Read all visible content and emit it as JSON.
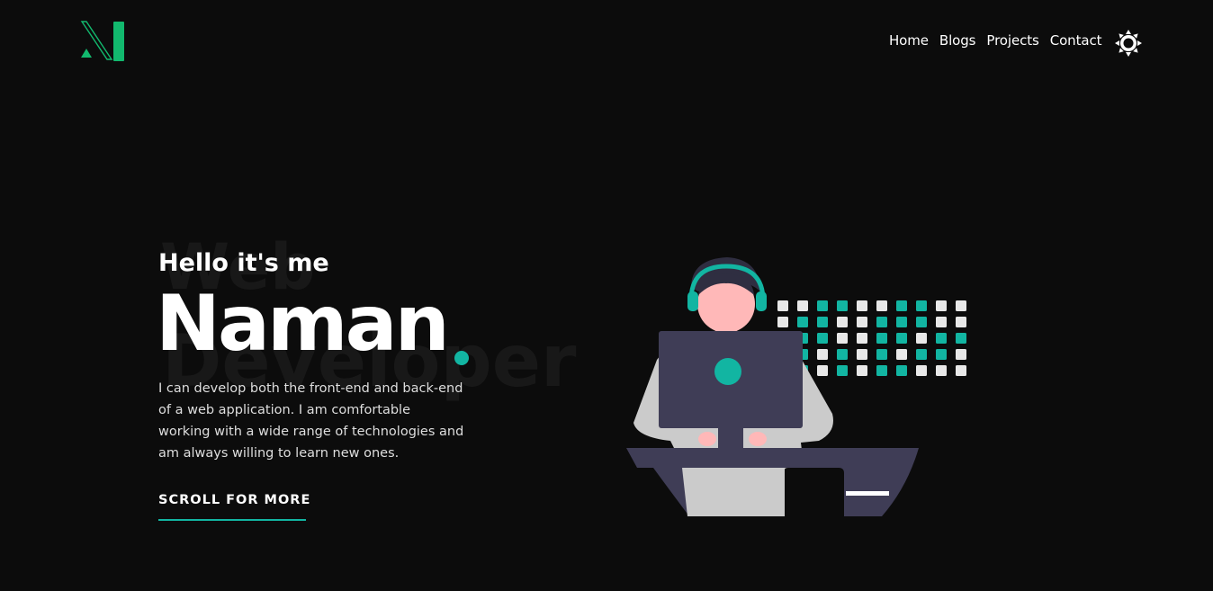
{
  "nav": {
    "items": [
      {
        "label": "Home"
      },
      {
        "label": "Blogs"
      },
      {
        "label": "Projects"
      },
      {
        "label": "Contact"
      }
    ],
    "theme_icon": "sun-icon"
  },
  "logo": {
    "icon": "n-logo-icon",
    "color": "#12b96e"
  },
  "hero": {
    "background_word_1": "Web",
    "background_word_2": "Developer",
    "greeting": "Hello it's me",
    "name": "Naman",
    "intro": "I can develop both the front-end and back-end of a web application. I am comfortable working with a wide range of technologies and am always willing to learn new ones.",
    "cta": "SCROLL FOR MORE"
  },
  "colors": {
    "background": "#0c0c0c",
    "accent": "#12b5a2",
    "logo_green": "#12b96e",
    "desk": "#3f3d56",
    "skin": "#ffb8b8"
  }
}
